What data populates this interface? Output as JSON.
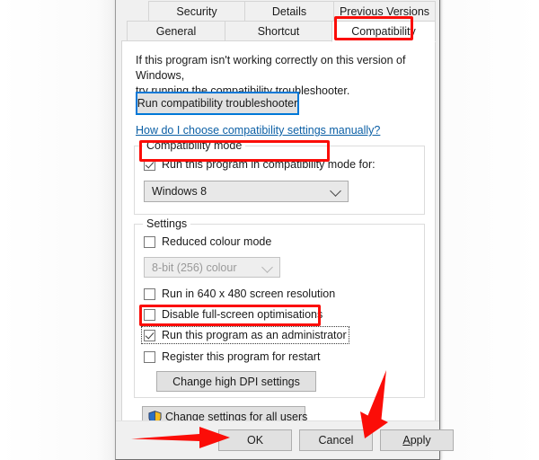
{
  "dialog": {
    "tabs_row1": [
      {
        "label": "Security",
        "active": false
      },
      {
        "label": "Details",
        "active": false
      },
      {
        "label": "Previous Versions",
        "active": false
      }
    ],
    "tabs_row2": [
      {
        "label": "General",
        "active": false
      },
      {
        "label": "Shortcut",
        "active": false
      },
      {
        "label": "Compatibility",
        "active": true
      }
    ],
    "intro_line1": "If this program isn't working correctly on this version of Windows,",
    "intro_line2": "try running the compatibility troubleshooter.",
    "troubleshoot_button": "Run compatibility troubleshooter",
    "manual_link": "How do I choose compatibility settings manually?",
    "compatibility_mode": {
      "legend": "Compatibility mode",
      "checkbox_label": "Run this program in compatibility mode for:",
      "checkbox_checked": "true",
      "combo_value": "Windows 8"
    },
    "settings": {
      "legend": "Settings",
      "reduced_colour_label": "Reduced colour mode",
      "reduced_colour_checked": "false",
      "colour_depth_value": "8-bit (256) colour",
      "colour_depth_enabled": "false",
      "resolution_label": "Run in 640 x 480 screen resolution",
      "resolution_checked": "false",
      "fullscreen_label": "Disable full-screen optimisations",
      "fullscreen_checked": "false",
      "admin_label": "Run this program as an administrator",
      "admin_checked": "true",
      "restart_label": "Register this program for restart",
      "restart_checked": "false",
      "dpi_button": "Change high DPI settings"
    },
    "all_users_button": "Change settings for all users",
    "footer": {
      "ok": "OK",
      "cancel": "Cancel",
      "apply_accel": "A",
      "apply_rest": "pply"
    }
  },
  "annotations": {
    "highlight_color": "#fb0d08",
    "focus_color": "#0078d7",
    "boxes": [
      {
        "target": "compatibility-tab"
      },
      {
        "target": "compatibility-mode-checkbox"
      },
      {
        "target": "run-as-administrator-checkbox"
      }
    ],
    "arrows": [
      {
        "target": "ok-button",
        "direction": "right"
      },
      {
        "target": "apply-button",
        "direction": "down-left"
      }
    ]
  }
}
